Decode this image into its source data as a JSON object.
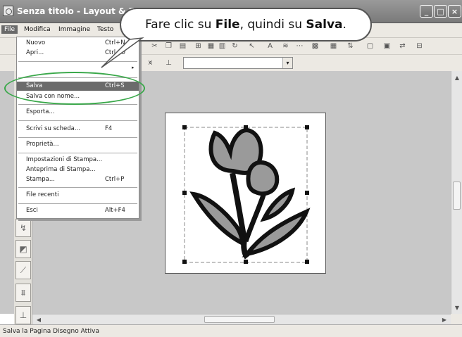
{
  "window": {
    "title": "Senza titolo - Layout & E",
    "controls": [
      "_",
      "□",
      "×"
    ]
  },
  "menubar": {
    "items": [
      "File",
      "Modifica",
      "Immagine",
      "Testo"
    ]
  },
  "file_menu": {
    "items": [
      {
        "label": "Nuovo",
        "shortcut": "Ctrl+N"
      },
      {
        "label": "Apri...",
        "shortcut": "Ctrl+O"
      },
      {
        "label": "Salva",
        "shortcut": "Ctrl+S"
      },
      {
        "label": "Salva con nome...",
        "shortcut": ""
      },
      {
        "label": "Esporta...",
        "shortcut": ""
      },
      {
        "label": "Scrivi su scheda...",
        "shortcut": "F4"
      },
      {
        "label": "Proprietà...",
        "shortcut": ""
      },
      {
        "label": "Impostazioni di Stampa...",
        "shortcut": ""
      },
      {
        "label": "Anteprima di Stampa...",
        "shortcut": ""
      },
      {
        "label": "Stampa...",
        "shortcut": "Ctrl+P"
      },
      {
        "label": "File recenti",
        "shortcut": ""
      },
      {
        "label": "Esci",
        "shortcut": "Alt+F4"
      }
    ],
    "highlighted": "Salva"
  },
  "callout": {
    "prefix": "Fare clic su ",
    "bold1": "File",
    "middle": ", quindi su ",
    "bold2": "Salva",
    "suffix": "."
  },
  "status": {
    "text": "Salva la Pagina Disegno Attiva"
  },
  "colors": {
    "highlight_ring": "#3aa84a",
    "menu_highlight": "#6b6b6b"
  }
}
